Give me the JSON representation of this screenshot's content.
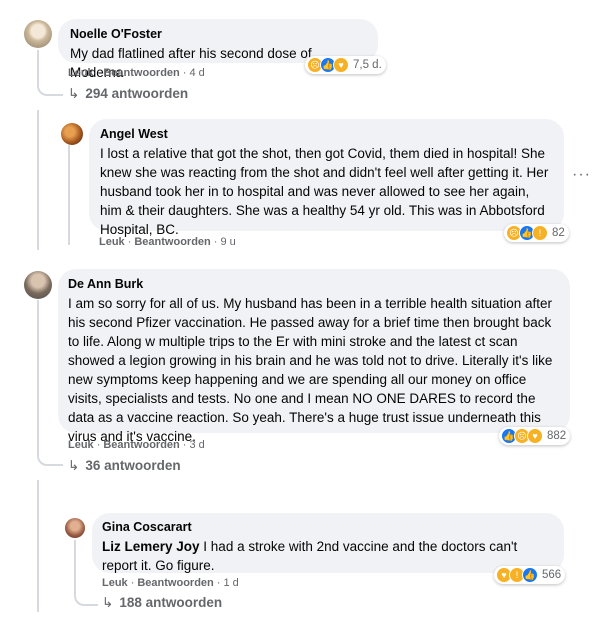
{
  "comments": [
    {
      "author": "Noelle O'Foster",
      "text": "My dad flatlined after his second dose of Moderna",
      "like": "Leuk",
      "reply": "Beantwoorden",
      "time": "4 d",
      "reaction_count": "7,5 d.",
      "reactions": [
        "sad-icon",
        "like-icon",
        "care-icon"
      ],
      "replies": "294 antwoorden"
    },
    {
      "author": "Angel West",
      "text": "I lost a relative that got the shot, then got Covid, them died in hospital! She knew she was reacting from the shot and didn't feel well after getting it. Her husband took her in to hospital and was never allowed to see her again, him & their daughters. She was a healthy 54 yr old. This was in Abbotsford Hospital, BC.",
      "like": "Leuk",
      "reply": "Beantwoorden",
      "time": "9 u",
      "reaction_count": "82",
      "reactions": [
        "sad-icon",
        "like-icon",
        "wow-icon"
      ],
      "more": "···"
    },
    {
      "author": "De Ann Burk",
      "text": "I am so sorry for all of us. My husband has been in a terrible health situation after his second Pfizer vaccination. He passed away for a brief time then brought back to life. Along w multiple trips to the Er with mini stroke and the latest ct scan showed a legion growing in his brain and he was told not to drive. Literally it's like new symptoms keep happening and we are spending all our money on office visits, specialists and tests. No one and I mean NO ONE DARES to record the data as a vaccine reaction. So yeah. There's a huge trust issue underneath this virus and it's vaccine.",
      "like": "Leuk",
      "reply": "Beantwoorden",
      "time": "3 d",
      "reaction_count": "882",
      "reactions": [
        "like-icon",
        "sad-icon",
        "care-icon"
      ],
      "replies": "36 antwoorden"
    },
    {
      "author": "Gina Coscarart",
      "tag": "Liz Lemery Joy",
      "text": " I had a stroke with 2nd vaccine and the doctors can't report it. Go figure.",
      "like": "Leuk",
      "reply": "Beantwoorden",
      "time": "1 d",
      "reaction_count": "566",
      "reactions": [
        "care-icon",
        "wow-icon",
        "like-icon"
      ],
      "replies": "188 antwoorden"
    }
  ],
  "colors": {
    "bubble": "#f0f2f5",
    "meta": "#65676b",
    "like": "#1877f2",
    "sad": "#f7b125"
  }
}
